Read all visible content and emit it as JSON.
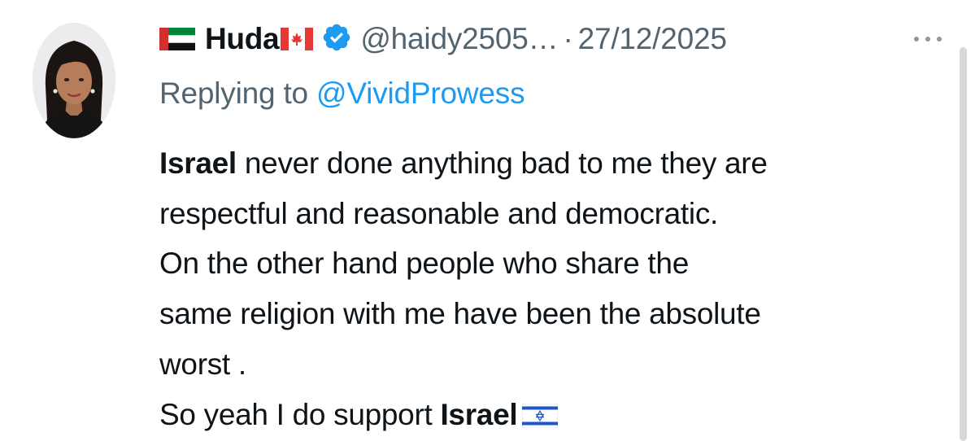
{
  "tweet": {
    "author": {
      "display_name": "Huda",
      "prefix_flag_icon": "uae-flag-icon",
      "suffix_flag_icon": "canada-flag-icon",
      "verified_icon": "verified-badge-icon",
      "handle": "@haidy2505…",
      "separator": "·",
      "timestamp": "27/12/2025"
    },
    "more_icon": "more-horizontal-icon",
    "reply": {
      "prefix": "Replying to ",
      "mention": "@VividProwess"
    },
    "body": {
      "line1_bold": "Israel",
      "line1_rest": " never done anything bad to me they are",
      "line2": "respectful and reasonable and democratic.",
      "line3": "On the other hand people who share the",
      "line4": "same religion with me have been the absolute",
      "line5": "worst .",
      "line6_prefix": "So yeah I do support ",
      "line6_bold": "Israel",
      "line6_icon": "israel-flag-icon"
    },
    "colors": {
      "text": "#0f1419",
      "secondary": "#536471",
      "link": "#1d9bf0",
      "verified": "#1d9bf0"
    }
  }
}
